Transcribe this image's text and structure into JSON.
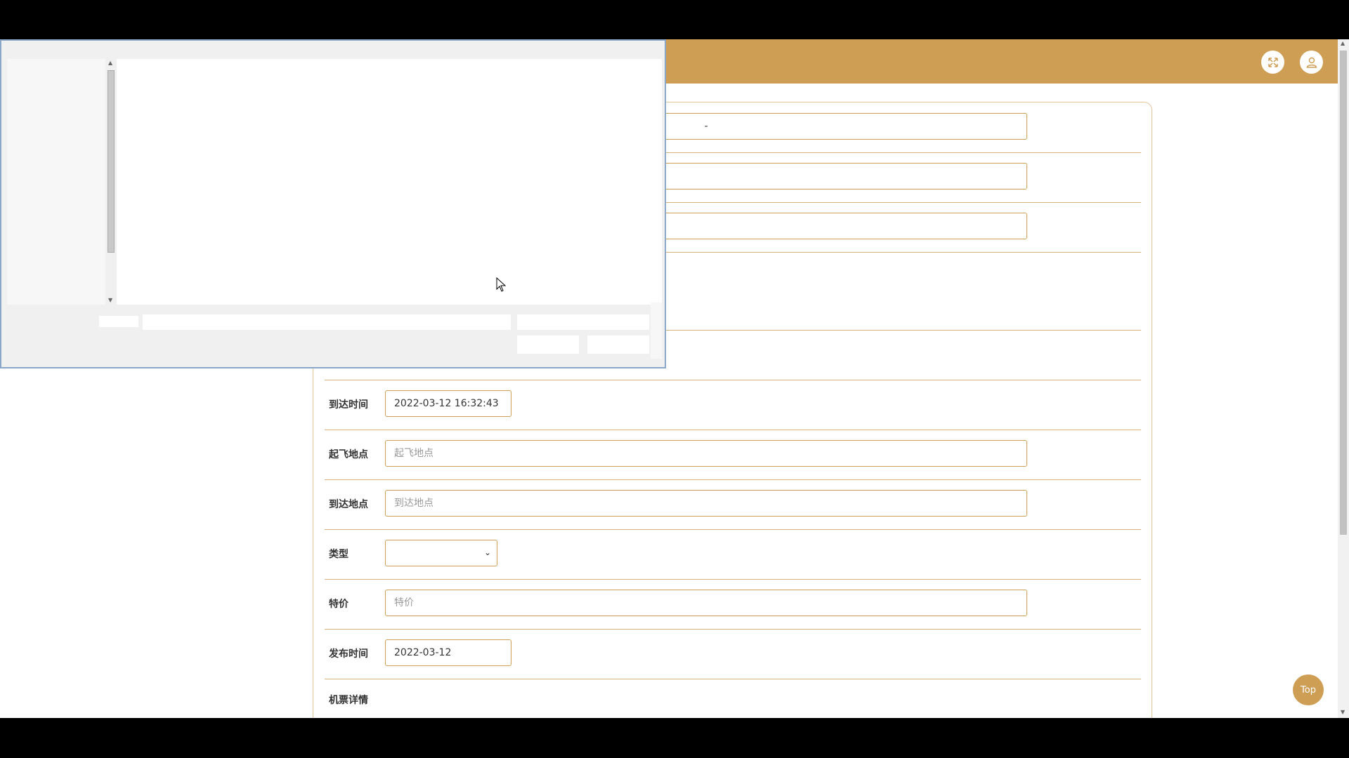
{
  "header": {
    "fullscreen_icon": "expand-icon",
    "user_icon": "user-icon"
  },
  "form": {
    "rows": [
      {
        "label": "到达时间",
        "value": "2022-03-12 16:32:43"
      },
      {
        "label": "起飞地点",
        "placeholder": "起飞地点"
      },
      {
        "label": "到达地点",
        "placeholder": "到达地点"
      },
      {
        "label": "类型",
        "value": ""
      },
      {
        "label": "特价",
        "placeholder": "特价"
      },
      {
        "label": "发布时间",
        "value": "2022-03-12"
      },
      {
        "label": "机票详情"
      }
    ],
    "top_row_value": "-"
  },
  "top_button": {
    "label": "Top"
  },
  "colors": {
    "accent": "#cf9e55"
  }
}
